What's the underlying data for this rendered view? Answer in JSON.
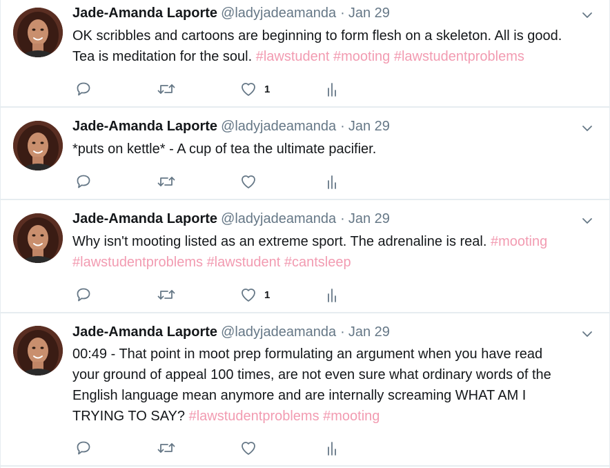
{
  "tweets": [
    {
      "name": "Jade-Amanda Laporte",
      "handle": "@ladyjadeamanda",
      "separator": "·",
      "date": "Jan 29",
      "lines": [
        [
          {
            "t": "OK scribbles and cartoons are beginning to form flesh on a skeleton. All is good."
          }
        ],
        [
          {
            "t": "Tea is meditation for the soul. "
          },
          {
            "t": "#lawstudent",
            "h": true
          },
          {
            "t": " "
          },
          {
            "t": "#mooting",
            "h": true
          },
          {
            "t": " "
          },
          {
            "t": "#lawstudentproblems",
            "h": true
          }
        ]
      ],
      "like_count": "1"
    },
    {
      "name": "Jade-Amanda Laporte",
      "handle": "@ladyjadeamanda",
      "separator": "·",
      "date": "Jan 29",
      "lines": [
        [
          {
            "t": "*puts on kettle* - A cup of tea the ultimate pacifier."
          }
        ]
      ],
      "like_count": ""
    },
    {
      "name": "Jade-Amanda Laporte",
      "handle": "@ladyjadeamanda",
      "separator": "·",
      "date": "Jan 29",
      "lines": [
        [
          {
            "t": "Why isn't mooting listed as an extreme sport. The adrenaline is real. "
          },
          {
            "t": "#mooting",
            "h": true
          }
        ],
        [
          {
            "t": "#lawstudentproblems",
            "h": true
          },
          {
            "t": " "
          },
          {
            "t": "#lawstudent",
            "h": true
          },
          {
            "t": " "
          },
          {
            "t": "#cantsleep",
            "h": true
          }
        ]
      ],
      "like_count": "1"
    },
    {
      "name": "Jade-Amanda Laporte",
      "handle": "@ladyjadeamanda",
      "separator": "·",
      "date": "Jan 29",
      "lines": [
        [
          {
            "t": "00:49 - That point in moot prep formulating an argument when you have read"
          }
        ],
        [
          {
            "t": "your ground of appeal 100 times, are not even sure what ordinary words of the"
          }
        ],
        [
          {
            "t": "English language mean anymore and are internally screaming WHAT AM I"
          }
        ],
        [
          {
            "t": "TRYING TO SAY? "
          },
          {
            "t": "#lawstudentproblems",
            "h": true
          },
          {
            "t": " "
          },
          {
            "t": "#mooting",
            "h": true
          }
        ]
      ],
      "like_count": ""
    }
  ],
  "icons": {
    "reply": "reply-icon",
    "retweet": "retweet-icon",
    "like": "heart-icon",
    "analytics": "analytics-icon",
    "more": "chevron-down-icon"
  },
  "colors": {
    "hashtag": "#f29bb1",
    "secondary_text": "#657786",
    "primary_text": "#14171a",
    "icon": "#657786",
    "divider": "#e6ecf0"
  }
}
